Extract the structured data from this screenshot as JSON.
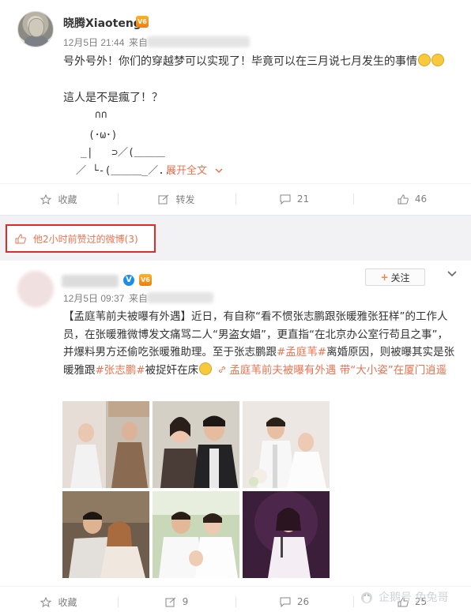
{
  "post1": {
    "username": "晓腾Xiaoteng",
    "vip_badge": "V6",
    "timestamp": "12月5日 21:44",
    "source_prefix": "来自",
    "text_line1": "号外号外！你们的穿越梦可以实现了！毕竟可以在三月说七月发生的事情",
    "text_line2": "這人是不是瘋了！？",
    "kaomoji": [
      "∩∩",
      "(･ω･)",
      "_|   ⊃／(＿＿＿",
      "／ └-(＿＿＿_／..."
    ],
    "expand_label": "展开全文",
    "actions": {
      "favorite": "收藏",
      "repost": "转发",
      "comment": "21",
      "like": "46"
    }
  },
  "liked_label": "他2小时前赞过的微博(3)",
  "post2": {
    "vip_badge": "V6",
    "follow_label": "关注",
    "timestamp": "12月5日 09:37",
    "source_prefix": "来自",
    "segments": [
      {
        "t": "【孟庭苇前夫被曝有外遇】近日，有自称“看不惯张志鹏跟张暖雅张狂样”的工作人员，在张暖雅微博发文痛骂二人“男盗女娼”，更直指“在北京办公室行苟且之事”，并爆料男方还偷吃张暖雅助理。至于张志鹏跟",
        "hl": false
      },
      {
        "t": "#孟庭苇#",
        "hl": true
      },
      {
        "t": "离婚原因，则被曝其实是张暖雅跟",
        "hl": false
      },
      {
        "t": "#张志鹏#",
        "hl": true
      },
      {
        "t": "被捉奸在床",
        "hl": false
      }
    ],
    "link_text": "孟庭苇前夫被曝有外遇 带“大小姿”在厦门逍遥",
    "photos": [
      "photo-1",
      "photo-2",
      "photo-3",
      "photo-4",
      "photo-5",
      "photo-6"
    ],
    "actions": {
      "favorite": "收藏",
      "repost": "9",
      "comment": "26",
      "like": "25"
    }
  },
  "watermark": "企鹅号 兔兔哥",
  "colors": {
    "accent": "#eb7350",
    "highlight_box": "#e22a2a",
    "muted": "#808080",
    "verified": "#1c8ee8"
  }
}
